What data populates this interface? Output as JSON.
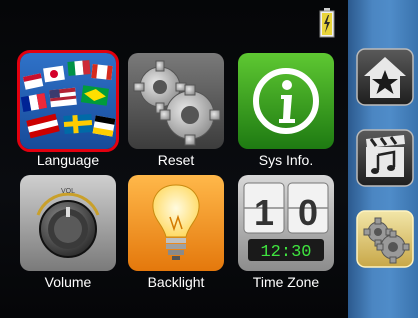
{
  "menu": {
    "tiles": [
      {
        "label": "Language",
        "icon": "language-flags-icon",
        "selected": true
      },
      {
        "label": "Reset",
        "icon": "gears-reset-icon"
      },
      {
        "label": "Sys Info.",
        "icon": "info-icon"
      },
      {
        "label": "Volume",
        "icon": "volume-knob-icon",
        "knob_marking": "VOL"
      },
      {
        "label": "Backlight",
        "icon": "light-bulb-icon"
      },
      {
        "label": "Time Zone",
        "icon": "flip-clock-icon",
        "flip_digits": "10",
        "digital_time": "12:30"
      }
    ]
  },
  "sidebar": {
    "items": [
      {
        "name": "favorites",
        "icon": "home-star-icon"
      },
      {
        "name": "media",
        "icon": "clapper-music-icon"
      },
      {
        "name": "settings",
        "icon": "settings-gears-icon",
        "active": true
      }
    ]
  },
  "status": {
    "battery_icon": "battery-charging-icon"
  },
  "colors": {
    "selection": "#e2000f",
    "sidebar": "#4b86c2",
    "active_button": "#e0c870"
  }
}
